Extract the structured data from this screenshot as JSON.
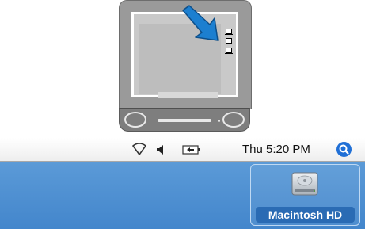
{
  "illustration": {
    "device": "imac",
    "arrow_target": "desktop-icons"
  },
  "menu_bar": {
    "icons": [
      "wifi-icon",
      "volume-icon",
      "battery-icon",
      "spotlight-icon"
    ],
    "clock": "Thu 5:20 PM"
  },
  "desktop": {
    "volume_label": "Macintosh HD",
    "volume_icon": "hard-drive-icon",
    "selection_color": "#2a6bb4",
    "background_color": "#4e90d2"
  }
}
